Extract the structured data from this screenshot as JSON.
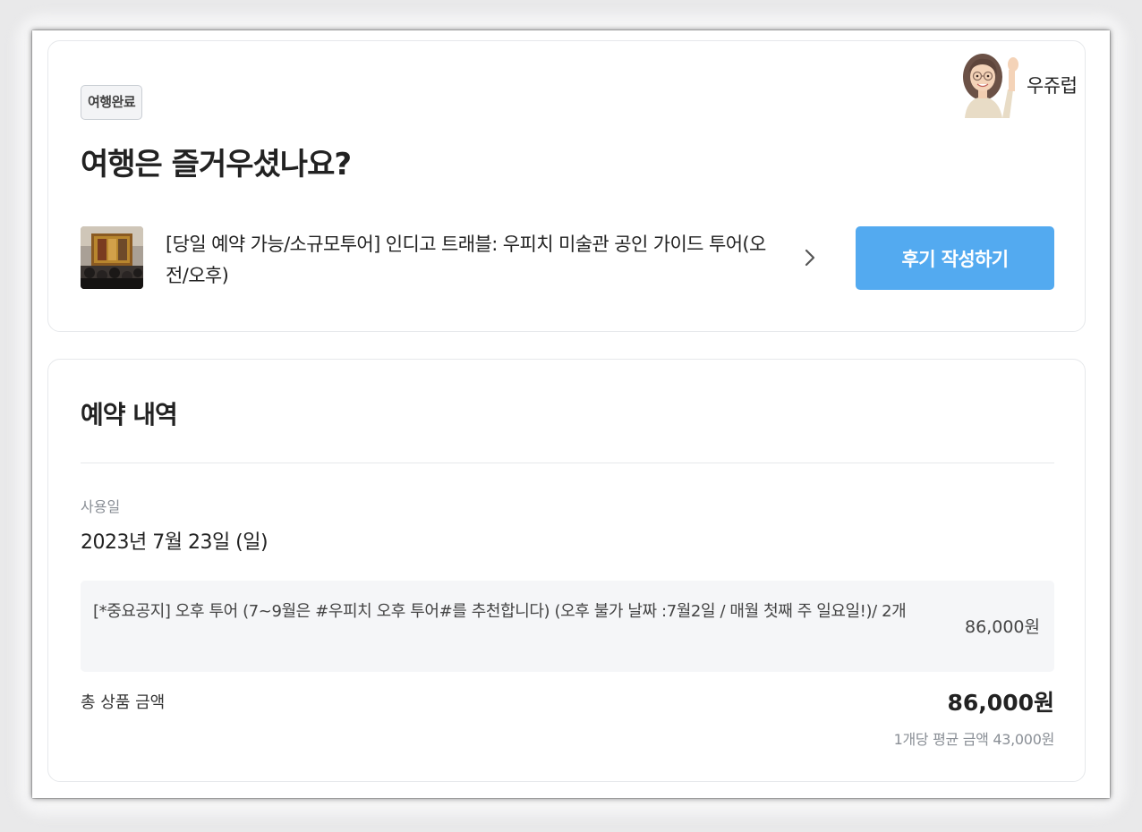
{
  "header": {
    "status_badge": "여행완료",
    "question": "여행은 즐거우셨나요?",
    "watermark_label": "우쥬럽"
  },
  "product": {
    "title": "[당일 예약 가능/소규모투어] 인디고 트래블: 우피치 미술관 공인 가이드 투어(오전/오후)",
    "review_button_label": "후기 작성하기",
    "thumbnail_icon": "museum-painting-thumbnail",
    "chevron_icon": "chevron-right-icon"
  },
  "booking": {
    "section_title": "예약 내역",
    "usage_label": "사용일",
    "usage_date": "2023년 7월 23일 (일)",
    "option_description": "[*중요공지] 오후 투어 (7~9월은 #우피치 오후 투어#를 추천합니다) (오후 불가 날짜 :7월2일 / 매월 첫째 주 일요일!)/ 2개",
    "option_price": "86,000원",
    "total_label": "총 상품 금액",
    "total_price": "86,000원",
    "average_price": "1개당 평균 금액 43,000원"
  },
  "colors": {
    "accent": "#53aaf0",
    "option_bg": "#f5f6f8",
    "muted_text": "#8a8f96"
  }
}
